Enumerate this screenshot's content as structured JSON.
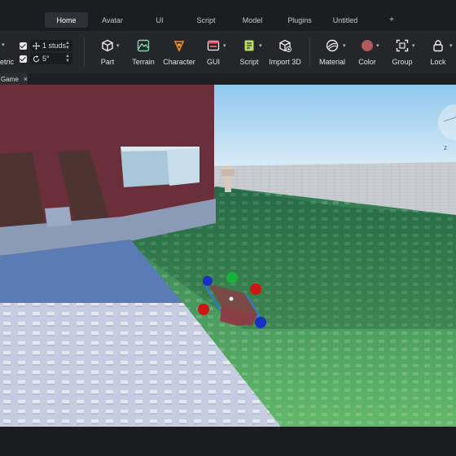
{
  "menu": {
    "tabs": [
      {
        "label": "Home",
        "active": true
      },
      {
        "label": "Avatar",
        "active": false
      },
      {
        "label": "UI",
        "active": false
      },
      {
        "label": "Script",
        "active": false
      },
      {
        "label": "Model",
        "active": false
      },
      {
        "label": "Plugins",
        "active": false
      },
      {
        "label": "Untitled",
        "active": false
      }
    ],
    "add_tab": "+"
  },
  "toolbar": {
    "transform_mode": "etric",
    "move_snap": {
      "enabled": true,
      "value": "1 studs"
    },
    "rotate_snap": {
      "enabled": true,
      "value": "5°"
    },
    "tools": {
      "part": "Part",
      "terrain": "Terrain",
      "character": "Character",
      "gui": "GUI",
      "script": "Script",
      "import3d": "Import 3D",
      "material": "Material",
      "color": "Color",
      "group": "Group",
      "lock": "Lock"
    },
    "colors": {
      "terrain_icon": "#7fd6b0",
      "character_icon": "#f28a2e",
      "gui_icon": "#e8566e",
      "script_icon": "#b7dd62",
      "color_swatch": "#b2595d"
    }
  },
  "document": {
    "tab_label": "Game",
    "close": "×"
  },
  "viewport": {
    "colors": {
      "sky": "#a9d4ef",
      "ground": "#5fa866",
      "wall": "#6a2f3a",
      "path": "#c7cde0",
      "selection": "#2f7bd6",
      "part": "#7a4a46"
    },
    "handles": [
      "green",
      "red",
      "blue"
    ]
  }
}
